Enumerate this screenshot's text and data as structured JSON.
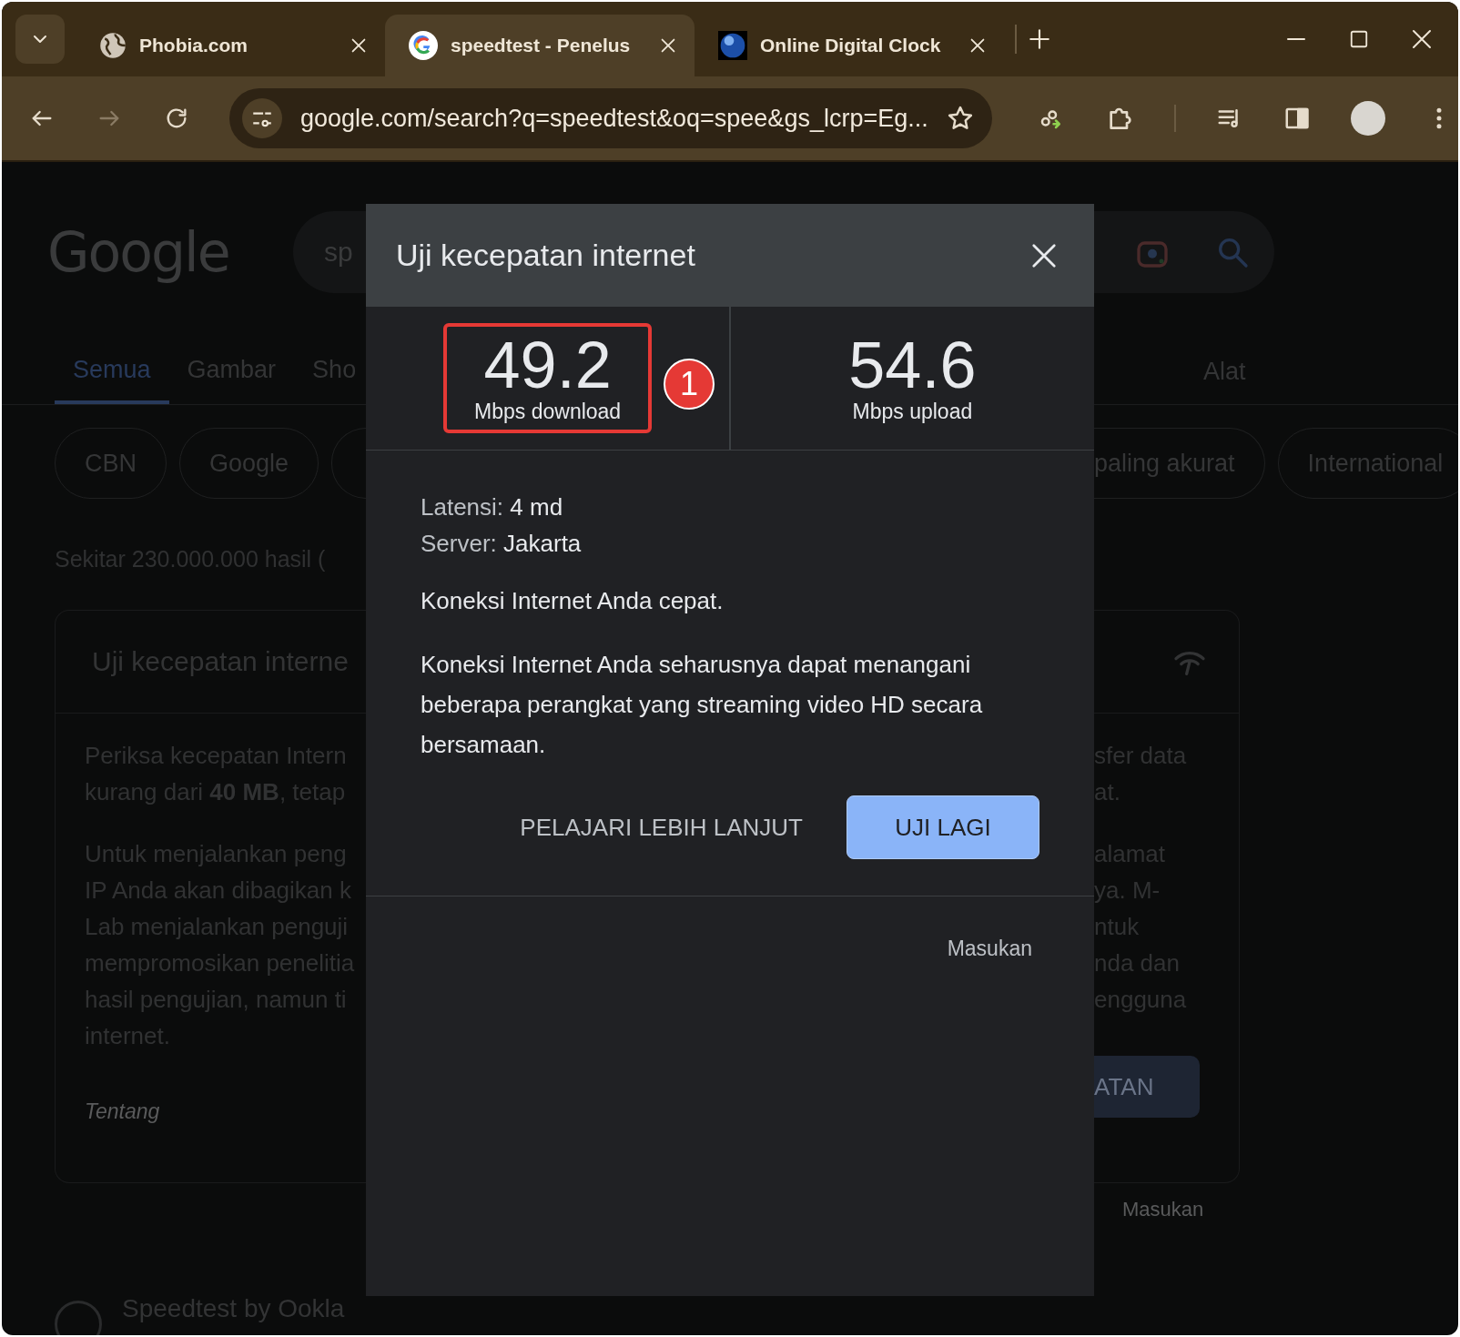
{
  "browser": {
    "tabs": [
      {
        "title": "Phobia.com",
        "selected": false
      },
      {
        "title": "speedtest - Penelus",
        "selected": true
      },
      {
        "title": "Online Digital Clock",
        "selected": false
      }
    ],
    "address": "google.com/search?q=speedtest&oq=spee&gs_lcrp=Eg..."
  },
  "page": {
    "logo": "Google",
    "search_query": "sp",
    "tabs": [
      {
        "label": "Semua",
        "selected": true
      },
      {
        "label": "Gambar",
        "selected": false
      },
      {
        "label": "Sho",
        "selected": false
      }
    ],
    "tools": "Alat",
    "chips_left": [
      "CBN",
      "Google"
    ],
    "chips_right": [
      "paling akurat",
      "International"
    ],
    "result_count": "Sekitar 230.000.000 hasil (",
    "card": {
      "title": "Uji kecepatan interne",
      "left_paragraphs": [
        [
          "Periksa kecepatan Intern",
          "kurang dari **40 MB**, tetap"
        ],
        [
          "Untuk menjalankan peng",
          "IP Anda akan dibagikan k",
          "Lab menjalankan penguji",
          "mempromosikan penelitia",
          "hasil pengujian, namun ti",
          "internet."
        ]
      ],
      "about": "Tentang",
      "right_paragraphs": [
        [
          "sfer data",
          "at."
        ],
        [
          "alamat",
          "ya. M-",
          "ntuk",
          "nda dan",
          "engguna"
        ]
      ],
      "button": "ATAN"
    },
    "feedback": "Masukan",
    "next_result": "Speedtest by Ookla"
  },
  "dialog": {
    "title": "Uji kecepatan internet",
    "download": {
      "value": "49.2",
      "unit": "Mbps download",
      "highlighted": true,
      "marker": "1"
    },
    "upload": {
      "value": "54.6",
      "unit": "Mbps upload"
    },
    "details": [
      {
        "label": "Latensi:",
        "value": "4 md"
      },
      {
        "label": "Server:",
        "value": "Jakarta"
      }
    ],
    "verdict": "Koneksi Internet Anda cepat.",
    "description": "Koneksi Internet Anda seharusnya dapat menangani beberapa perangkat yang streaming video HD secara bersamaan.",
    "learn_more": "PELAJARI LEBIH LANJUT",
    "retest": "UJI LAGI",
    "feedback": "Masukan"
  }
}
